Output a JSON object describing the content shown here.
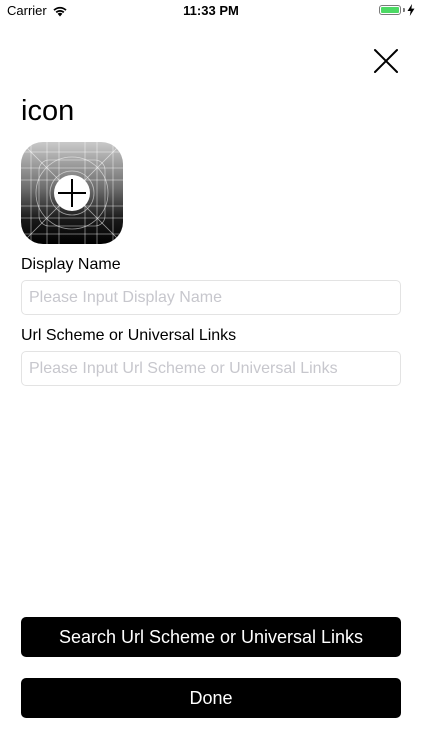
{
  "status_bar": {
    "carrier": "Carrier",
    "time": "11:33 PM",
    "wifi_icon": "wifi-icon",
    "battery_icon": "battery-icon",
    "battery_level": 1.0,
    "battery_color": "#4cd964",
    "charging_icon": "bolt-icon"
  },
  "header": {
    "close_icon": "close-icon"
  },
  "icon_section": {
    "title": "icon",
    "app_icon": "app-icon-placeholder-with-plus"
  },
  "form": {
    "display_name": {
      "label": "Display Name",
      "value": "",
      "placeholder": "Please Input Display Name"
    },
    "url_scheme": {
      "label": "Url Scheme or Universal Links",
      "value": "",
      "placeholder": "Please Input Url Scheme or Universal Links"
    }
  },
  "buttons": {
    "search_label": "Search Url Scheme or Universal Links",
    "done_label": "Done"
  },
  "colors": {
    "button_background": "#000000",
    "button_text": "#ffffff",
    "placeholder": "#c7c7cd",
    "input_border": "#e3e3e3"
  }
}
